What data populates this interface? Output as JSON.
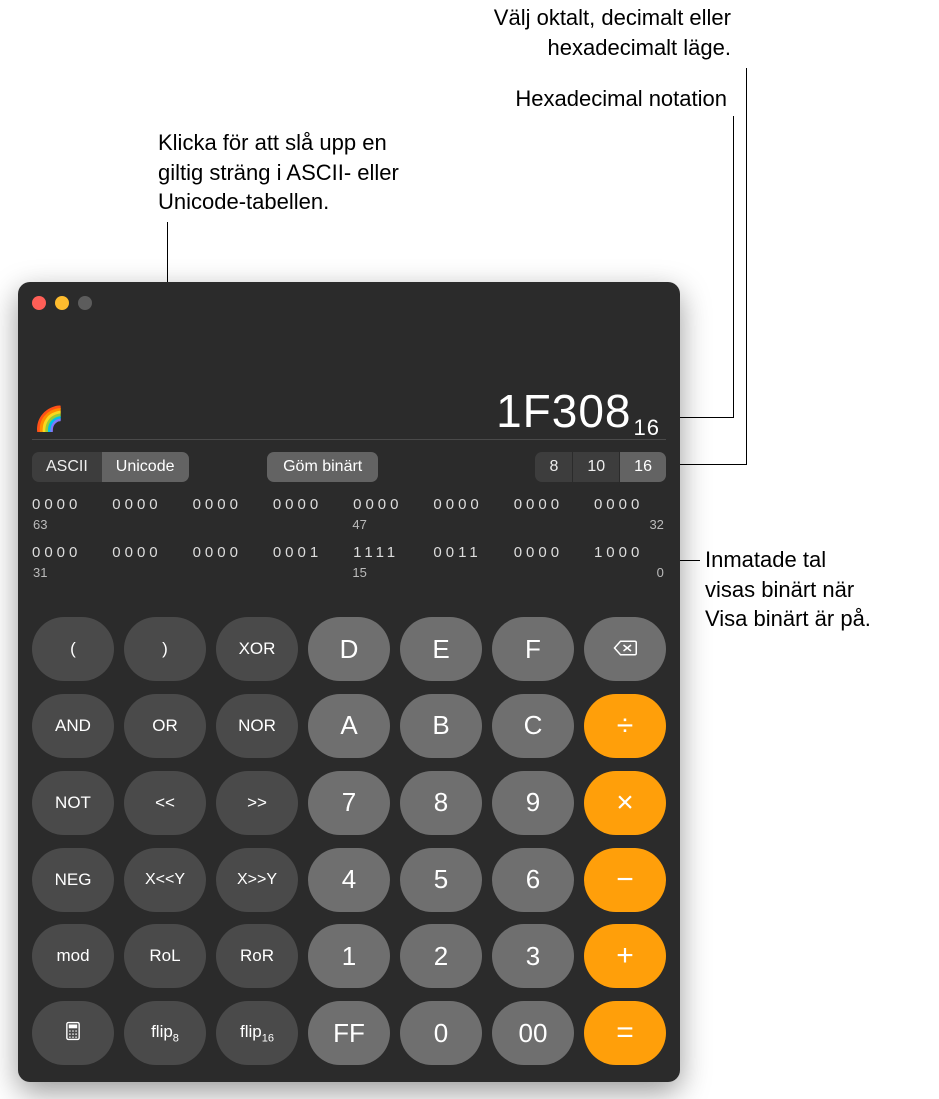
{
  "callouts": {
    "mode": "Välj oktalt, decimalt eller\nhexadecimalt läge.",
    "hex": "Hexadecimal notation",
    "ascii": "Klicka för att slå upp en\ngiltig sträng i ASCII- eller\nUnicode-tabellen.",
    "binary": "Inmatade tal\nvisas binärt när\nVisa binärt är på."
  },
  "display": {
    "glyph": "🌈",
    "value": "1F308",
    "base_sub": "16"
  },
  "controls": {
    "ascii_label": "ASCII",
    "unicode_label": "Unicode",
    "hide_binary_label": "Göm binärt",
    "base8": "8",
    "base10": "10",
    "base16": "16"
  },
  "binary": {
    "row1": [
      "0000",
      "0000",
      "0000",
      "0000",
      "0000",
      "0000",
      "0000",
      "0000"
    ],
    "idx1_left": "63",
    "idx1_mid": "47",
    "idx1_right": "32",
    "row2": [
      "0000",
      "0000",
      "0000",
      "0001",
      "1111",
      "0011",
      "0000",
      "1000"
    ],
    "idx2_left": "31",
    "idx2_mid": "15",
    "idx2_right": "0"
  },
  "keys": {
    "r1": [
      "(",
      ")",
      "XOR",
      "D",
      "E",
      "F"
    ],
    "r2": [
      "AND",
      "OR",
      "NOR",
      "A",
      "B",
      "C",
      "÷"
    ],
    "r3": [
      "NOT",
      "<<",
      ">>",
      "7",
      "8",
      "9",
      "×"
    ],
    "r4": [
      "NEG",
      "X<<Y",
      "X>>Y",
      "4",
      "5",
      "6",
      "−"
    ],
    "r5": [
      "mod",
      "RoL",
      "RoR",
      "1",
      "2",
      "3",
      "+"
    ],
    "r6": {
      "flip8": "flip",
      "flip8_sub": "8",
      "flip16": "flip",
      "flip16_sub": "16",
      "FF": "FF",
      "zero": "0",
      "dz": "00",
      "eq": "="
    }
  }
}
